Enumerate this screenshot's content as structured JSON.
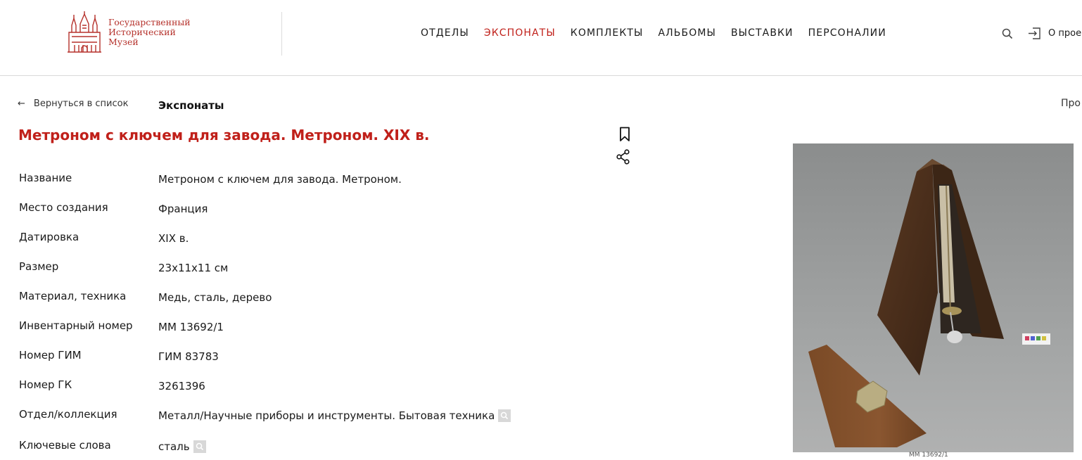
{
  "header": {
    "logo_lines": [
      "Государственный",
      "Исторический",
      "Музей"
    ],
    "nav": [
      {
        "label": "ОТДЕЛЫ",
        "active": false
      },
      {
        "label": "ЭКСПОНАТЫ",
        "active": true
      },
      {
        "label": "КОМПЛЕКТЫ",
        "active": false
      },
      {
        "label": "АЛЬБОМЫ",
        "active": false
      },
      {
        "label": "ВЫСТАВКИ",
        "active": false
      },
      {
        "label": "ПЕРСОНАЛИИ",
        "active": false
      }
    ],
    "login_label": "О прое",
    "accent_color": "#c0201a"
  },
  "breadcrumb": {
    "back_label": "Вернуться в список",
    "section_title": "Экспонаты",
    "right_cut": "Про"
  },
  "item": {
    "title": "Метроном с ключем для завода. Метроном. XIX в.",
    "properties": [
      {
        "label": "Название",
        "value": "Метроном с ключем для завода. Метроном.",
        "searchable": false
      },
      {
        "label": "Место создания",
        "value": "Франция",
        "searchable": false
      },
      {
        "label": "Датировка",
        "value": "XIX в.",
        "searchable": false
      },
      {
        "label": "Размер",
        "value": "23х11х11 см",
        "searchable": false
      },
      {
        "label": "Материал, техника",
        "value": "Медь, сталь, дерево",
        "searchable": false
      },
      {
        "label": "Инвентарный номер",
        "value": "ММ 13692/1",
        "searchable": false
      },
      {
        "label": "Номер ГИМ",
        "value": "ГИМ 83783",
        "searchable": false
      },
      {
        "label": "Номер ГК",
        "value": "3261396",
        "searchable": false
      },
      {
        "label": "Отдел/коллекция",
        "value": "Металл/Научные приборы и инструменты. Бытовая техника",
        "searchable": true
      },
      {
        "label": "Ключевые слова",
        "value": "сталь",
        "searchable": true
      }
    ],
    "photo_caption": "ММ 13692/1"
  }
}
